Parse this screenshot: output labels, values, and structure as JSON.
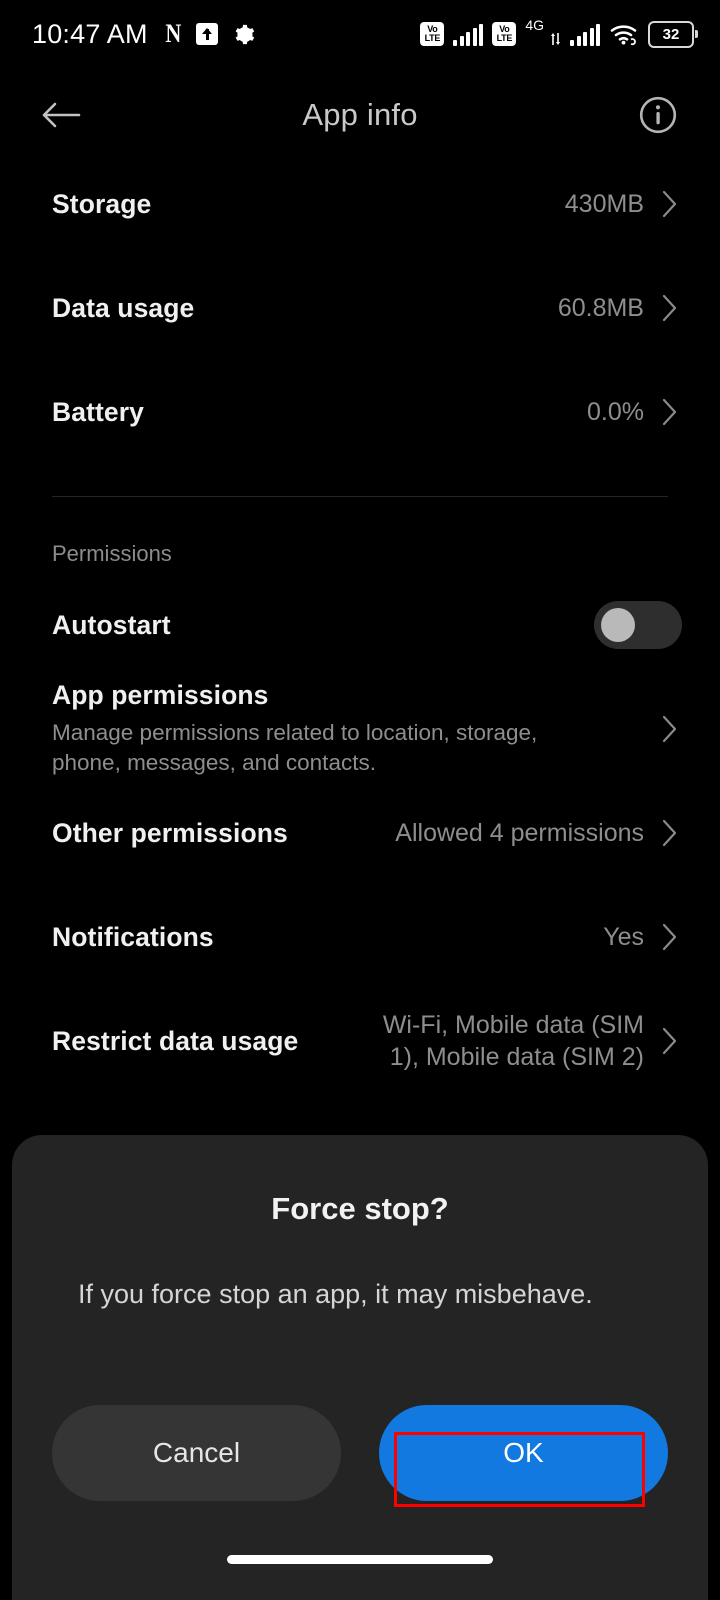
{
  "statusbar": {
    "time": "10:47 AM",
    "left_icons": [
      "netflix-n-icon",
      "upload-icon",
      "gear-icon"
    ],
    "volte_line1": "Vo",
    "volte_line2": "LTE",
    "network_type": "4G",
    "battery_level": "32",
    "right_icons": [
      "volte-icon",
      "signal-bars-icon",
      "volte-icon",
      "signal-bars-icon",
      "wifi-icon",
      "battery-icon"
    ]
  },
  "appbar": {
    "title": "App info",
    "back_icon": "back-arrow-icon",
    "info_icon": "info-circle-icon"
  },
  "list": {
    "rows": [
      {
        "title": "Storage",
        "value": "430MB"
      },
      {
        "title": "Data usage",
        "value": "60.8MB"
      },
      {
        "title": "Battery",
        "value": "0.0%"
      }
    ],
    "section_label": "Permissions",
    "autostart": {
      "title": "Autostart",
      "state": "off"
    },
    "app_permissions": {
      "title": "App permissions",
      "subtitle": "Manage permissions related to location, storage, phone, messages, and contacts."
    },
    "other_permissions": {
      "title": "Other permissions",
      "value": "Allowed 4 permissions"
    },
    "notifications": {
      "title": "Notifications",
      "value": "Yes"
    },
    "restrict_data": {
      "title": "Restrict data usage",
      "value": "Wi-Fi, Mobile data (SIM 1), Mobile data (SIM 2)"
    }
  },
  "dialog": {
    "title": "Force stop?",
    "message": "If you force stop an app, it may misbehave.",
    "cancel_label": "Cancel",
    "ok_label": "OK"
  },
  "colors": {
    "background": "#000000",
    "dialog_background": "#242424",
    "accent_blue": "#1279e0",
    "cancel_grey": "#353535",
    "highlight_red": "#ff0000",
    "primary_text": "#f0f0f0",
    "secondary_text": "#8e8e8e"
  }
}
